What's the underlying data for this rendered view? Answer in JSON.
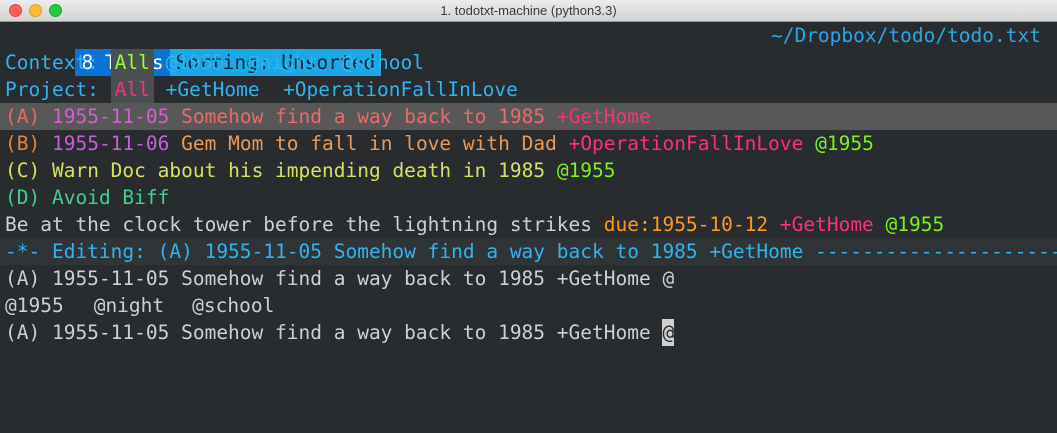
{
  "window": {
    "title": "1. todotxt-machine (python3.3)"
  },
  "status": {
    "count": "8 Todos",
    "sorting": "Sorting: Unsorted",
    "path": "~/Dropbox/todo/todo.txt"
  },
  "context": {
    "label": "Context:",
    "items": [
      "All",
      "@1955",
      "@night",
      "@school"
    ]
  },
  "project": {
    "label": "Project:",
    "items": [
      "All",
      "+GetHome",
      "+OperationFallInLove"
    ]
  },
  "todos": [
    {
      "priority": "(A)",
      "date": "1955-11-05",
      "text": "Somehow find a way back to 1985",
      "project": "+GetHome"
    },
    {
      "priority": "(B)",
      "date": "1955-11-06",
      "text": "Gem Mom to fall in love with Dad",
      "project": "+OperationFallInLove",
      "context": "@1955"
    },
    {
      "priority": "(C)",
      "text": "Warn Doc about his impending death in 1985",
      "context": "@1955"
    },
    {
      "priority": "(D)",
      "text": "Avoid Biff"
    },
    {
      "text": "Be at the clock tower before the lightning strikes",
      "due": "due:1955-10-12",
      "project": "+GetHome",
      "context": "@1955"
    }
  ],
  "editor": {
    "header": "-*- Editing: (A) 1955-11-05 Somehow find a way back to 1985 +GetHome ----------------------------------------",
    "completion_line": "(A) 1955-11-05 Somehow find a way back to 1985 +GetHome @",
    "suggestions": [
      "@1955",
      "@night",
      "@school"
    ],
    "input_value": "(A) 1955-11-05 Somehow find a way back to 1985 +GetHome ",
    "cursor_char": "@"
  },
  "colors": {
    "accent_blue": "#0a74d6",
    "accent_cyan": "#1ba8e6",
    "project_pink": "#ff2e7a",
    "context_green": "#7cf21b",
    "due_orange": "#ff9a1a"
  }
}
